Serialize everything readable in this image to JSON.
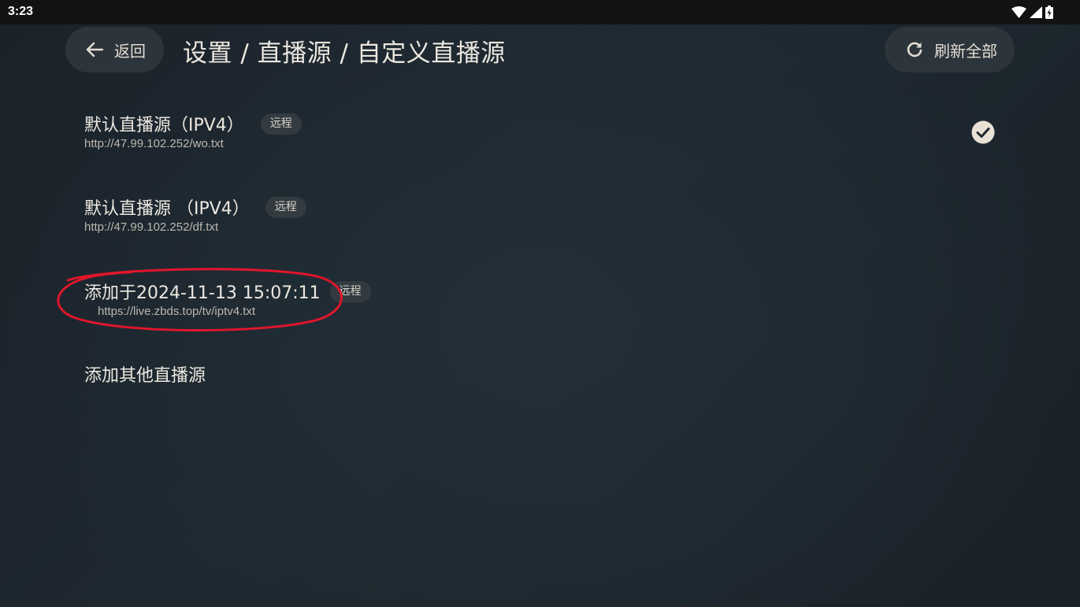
{
  "status_bar": {
    "time": "3:23",
    "icons": [
      "wifi-icon",
      "cell-signal-icon",
      "battery-charging-icon"
    ]
  },
  "header": {
    "back_label": "返回",
    "title": "设置 / 直播源 / 自定义直播源",
    "refresh_label": "刷新全部"
  },
  "sources": [
    {
      "title": "默认直播源（IPV4）",
      "tag": "远程",
      "url": "http://47.99.102.252/wo.txt",
      "selected": true
    },
    {
      "title": "默认直播源 （IPV4）",
      "tag": "远程",
      "url": "http://47.99.102.252/df.txt",
      "selected": false
    },
    {
      "title": "添加于2024-11-13 15:07:11",
      "tag": "远程",
      "url": "https://live.zbds.top/tv/iptv4.txt",
      "selected": false
    }
  ],
  "add_other_label": "添加其他直播源",
  "colors": {
    "background": "#1e2830",
    "pill": "#2d353c",
    "annotation": "#e0162b"
  }
}
